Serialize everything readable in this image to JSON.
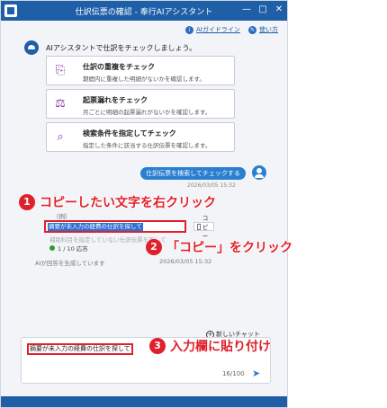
{
  "window": {
    "title": "仕訳伝票の確認 - 奉行AIアシスタント",
    "controls": [
      "—",
      "□",
      "✕"
    ]
  },
  "toolbar": {
    "guideline_label": "AIガイドライン",
    "howto_label": "使い方"
  },
  "chat": {
    "greeting": "AIアシスタントで仕訳をチェックしましょう。",
    "options": [
      {
        "icon": "duplicate-check-icon",
        "title": "仕訳の重複をチェック",
        "desc": "期間内に重複した明細がないかを確認します。"
      },
      {
        "icon": "scale-icon",
        "title": "起票漏れをチェック",
        "desc": "月ごとに明細の起票漏れがないかを確認します。"
      },
      {
        "icon": "search-condition-icon",
        "title": "検索条件を指定してチェック",
        "desc": "指定した条件に該当する仕訳伝票を確認します。"
      }
    ],
    "user_message": "仕訳伝票を検索してチェックする",
    "user_timestamp": "2026/03/05 15:32",
    "response": {
      "header": "（例）",
      "selected_text": "摘要が未入力の経費の仕訳を探して",
      "copy_label": "コピー",
      "line2": "補助科目を指定していない仕訳伝票を探して",
      "count_text": "1 / 10 応答",
      "status": "AIが回答を生成しています",
      "timestamp": "2026/03/05 15:32"
    },
    "new_chat_label": "新しいチャット",
    "input": {
      "value": "摘要が未入力の経費の仕訳を探して",
      "count": "16/100"
    }
  },
  "annotations": {
    "step1": {
      "number": "1",
      "text": "コピーしたい文字を右クリック"
    },
    "step2": {
      "number": "2",
      "text": "「コピー」をクリック"
    },
    "step3": {
      "number": "3",
      "text": "入力欄に貼り付け"
    }
  },
  "colors": {
    "brand": "#1f5fa8",
    "accent": "#2a7fd0",
    "annotation": "#e0202a"
  }
}
